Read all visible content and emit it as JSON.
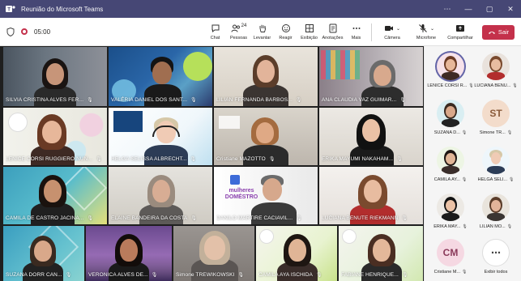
{
  "window": {
    "title": "Reunião do Microsoft Teams",
    "controls": [
      "⋯",
      "—",
      "▢",
      "✕"
    ]
  },
  "toolbar": {
    "time": "05:00",
    "people_count": "24",
    "tools": [
      {
        "label": "Chat",
        "icon": "chat-icon"
      },
      {
        "label": "Pessoas",
        "icon": "people-icon"
      },
      {
        "label": "Levantar",
        "icon": "raise-hand-icon"
      },
      {
        "label": "Reagir",
        "icon": "react-icon"
      },
      {
        "label": "Exibição",
        "icon": "view-icon"
      },
      {
        "label": "Anotações",
        "icon": "notes-icon"
      },
      {
        "label": "Mais",
        "icon": "more-icon"
      }
    ],
    "camera_label": "Câmera",
    "mic_label": "Microfone",
    "share_label": "Compartilhar",
    "leave_label": "Sair",
    "colors": {
      "leave": "#c4314b",
      "titlebar": "#464775"
    }
  },
  "tiles": [
    {
      "name": "SILVIA CRISTINA ALVES FER..."
    },
    {
      "name": "VALÉRIA DANIEL DOS SANT..."
    },
    {
      "name": "LILIAN FERNANDA BARBOS..."
    },
    {
      "name": "ANA CLAUDIA VAZ GUIMAR..."
    },
    {
      "name": "LENICE CORSI RUGGIERO NUN..."
    },
    {
      "name": "HELGA SELISSA ALBRECHT..."
    },
    {
      "name": "Cristiane MAZOTTO"
    },
    {
      "name": "ERIKA MAYUMI NAKAHAM..."
    },
    {
      "name": "CAMILA DE CASTRO JACINA..."
    },
    {
      "name": "ELAINE BANDEIRA DA COSTA"
    },
    {
      "name": "DANILO MARTIRE CACIAVIL..."
    },
    {
      "name": "LUCIANA BENUTE RIEKMANN"
    },
    {
      "name": "SUZANA DORR CAN..."
    },
    {
      "name": "VERONICA ALVES DE..."
    },
    {
      "name": "Simone TREWIKOWSKI"
    },
    {
      "name": "CAMILA AYA ISCHIDA"
    },
    {
      "name": "FABIANE HENRIQUE..."
    }
  ],
  "tile_texts": {
    "mulheres_domestico": "mulheres DOMÉSTRO"
  },
  "panel": [
    {
      "name": "LENICE CORSI R...",
      "initials": ""
    },
    {
      "name": "LUCIANA BENU...",
      "initials": ""
    },
    {
      "name": "SUZANA D...",
      "initials": ""
    },
    {
      "name": "Simone TR...",
      "initials": "ST"
    },
    {
      "name": "CAMILA AY...",
      "initials": ""
    },
    {
      "name": "HELGA SELI...",
      "initials": ""
    },
    {
      "name": "ERIKA MAY...",
      "initials": ""
    },
    {
      "name": "LILIAN MO...",
      "initials": ""
    },
    {
      "name": "Cristiane M...",
      "initials": "CM"
    },
    {
      "name": "Exibir todos",
      "initials": "⋯"
    }
  ]
}
